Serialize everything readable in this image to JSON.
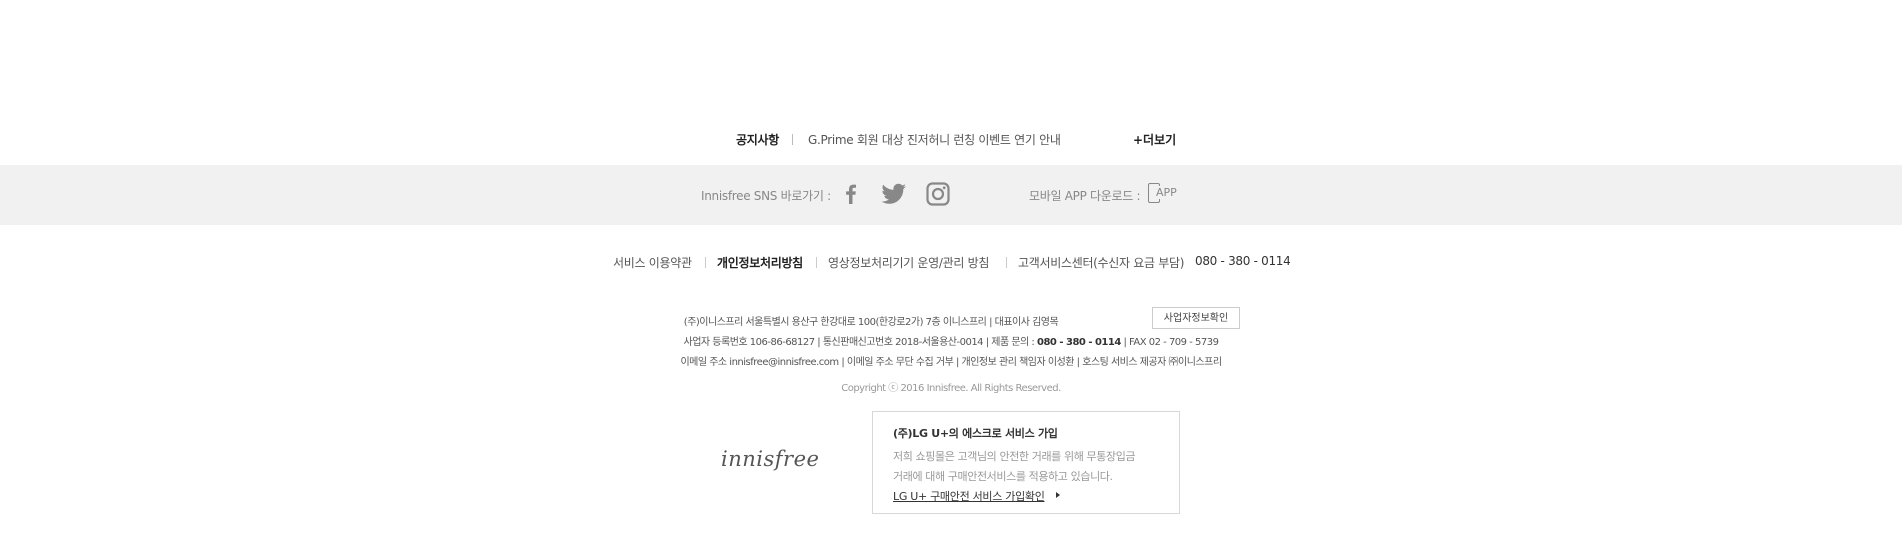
{
  "notice": {
    "title": "공지사항",
    "text": "G.Prime 회원 대상 진저허니 런칭 이벤트 연기 안내",
    "more": "+더보기"
  },
  "sns": {
    "label": "Innisfree SNS 바로가기 :",
    "icons": [
      "facebook-icon",
      "twitter-icon",
      "instagram-icon"
    ],
    "app_label": "모바일 APP 다운로드 :",
    "app_icon_text": "APP"
  },
  "links": {
    "terms": "서비스 이용약관",
    "privacy": "개인정보처리방침",
    "cctv": "영상정보처리기기 운영/관리 방침",
    "service_center": "고객서비스센터(수신자 요금 부담)",
    "phone": "080 - 380 - 0114"
  },
  "company": {
    "line1": "(주)이니스프리 서울특별시 용산구 한강대로 100(한강로2가) 7층 이니스프리 | 대표이사 김영목",
    "biz_button": "사업자정보확인",
    "line2_prefix": "사업자 등록번호 106-86-68127 | 통신판매신고번호 2018-서울용산-0014 | 제품 문의 :",
    "line2_phone": "080 - 380 - 0114",
    "line2_fax": "| FAX 02 - 709 - 5739",
    "line3": "이메일 주소 innisfree@innisfree.com | 이메일 주소 무단 수집 거부 | 개인정보 관리 책임자 이성환 | 호스팅 서비스 제공자 ㈜이니스프리",
    "copyright": "Copyright ⓒ 2016 Innisfree. All Rights Reserved."
  },
  "logo": "innisfree",
  "escrow": {
    "title": "(주)LG U+의 에스크로 서비스 가입",
    "desc1": "저희 쇼핑몰은 고객님의 안전한 거래를 위해 무통장입금",
    "desc2": "거래에 대해 구매안전서비스를 적용하고 있습니다.",
    "link": "LG U+ 구매안전 서비스 가입확인"
  },
  "colors": {
    "sns_bar_bg": "#f1f1f1",
    "icon_gray": "#888888"
  }
}
